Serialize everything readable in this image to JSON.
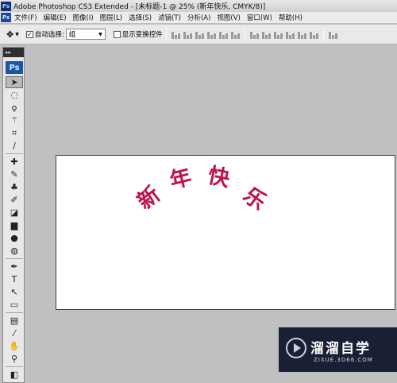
{
  "titlebar": {
    "title": "Adobe Photoshop CS3 Extended - [未标题-1 @ 25% (新年快乐, CMYK/8)]",
    "app_icon_text": "Ps"
  },
  "menubar": {
    "logo_text": "Ps",
    "items": [
      {
        "label": "文件(F)"
      },
      {
        "label": "编辑(E)"
      },
      {
        "label": "图像(I)"
      },
      {
        "label": "图层(L)"
      },
      {
        "label": "选择(S)"
      },
      {
        "label": "滤镜(T)"
      },
      {
        "label": "分析(A)"
      },
      {
        "label": "视图(V)"
      },
      {
        "label": "窗口(W)"
      },
      {
        "label": "帮助(H)"
      }
    ]
  },
  "options": {
    "tool_preset_icon": "move-icon",
    "auto_select_label": "自动选择:",
    "auto_select_checked": true,
    "auto_select_value": "组",
    "show_transform_label": "显示变换控件",
    "show_transform_checked": false
  },
  "toolbox": {
    "grip_text": "▸▸",
    "logo_text": "Ps"
  },
  "document": {
    "text": "新年快乐",
    "text_color": "#c0104f",
    "glyphs": [
      "新",
      "年",
      "快",
      "乐"
    ]
  },
  "watermark": {
    "name": "溜溜自学",
    "url": "ZIXUE.3D66.COM"
  }
}
